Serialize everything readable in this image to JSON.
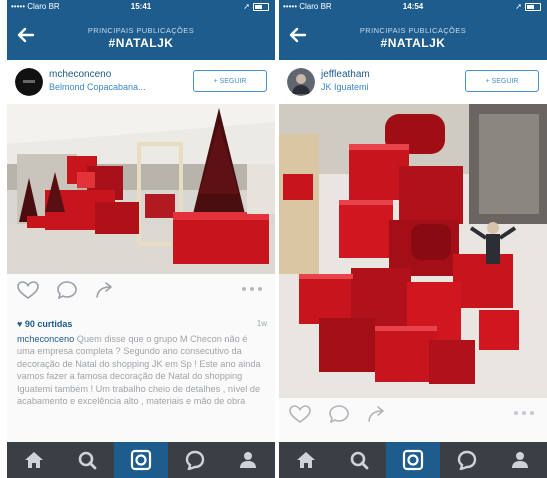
{
  "screens": [
    {
      "status": {
        "carrier": "••••• Claro BR",
        "time": "15:41"
      },
      "nav": {
        "subtitle": "PRINCIPAIS PUBLICAÇÕES",
        "title": "#NATALJK"
      },
      "post": {
        "username": "mcheconceno",
        "location": "Belmond Copacabana...",
        "follow_label": "+ SEGUIR",
        "likes": "♥ 90 curtidas",
        "time_ago": "1w",
        "caption_user": "mcheconceno",
        "caption_text": "Quem disse que o grupo M Checon não é uma empresa completa ? Segundo ano consecutivo da decoração de Natal do shopping JK em Sp ! Este ano ainda vamos fazer a famosa decoração de Natal do shopping Iguatemi também ! Um trabalho cheio de detalhes , nível de acabamento e excelência alto , materiais e mão de obra"
      }
    },
    {
      "status": {
        "carrier": "••••• Claro BR",
        "time": "14:54"
      },
      "nav": {
        "subtitle": "PRINCIPAIS PUBLICAÇÕES",
        "title": "#NATALJK"
      },
      "post": {
        "username": "jeffleatham",
        "location": "JK Iguatemi",
        "follow_label": "+ SEGUIR"
      }
    }
  ],
  "icons": [
    "back-arrow-icon",
    "heart-icon",
    "comment-icon",
    "share-icon",
    "more-icon",
    "home-icon",
    "search-icon",
    "camera-icon",
    "activity-icon",
    "profile-icon"
  ],
  "colors": {
    "nav": "#1d5c8d",
    "tabbar": "#3a3f45",
    "tab_active": "#1d5c8d",
    "link": "#3a87c7",
    "gift_red": "#c8141c"
  }
}
